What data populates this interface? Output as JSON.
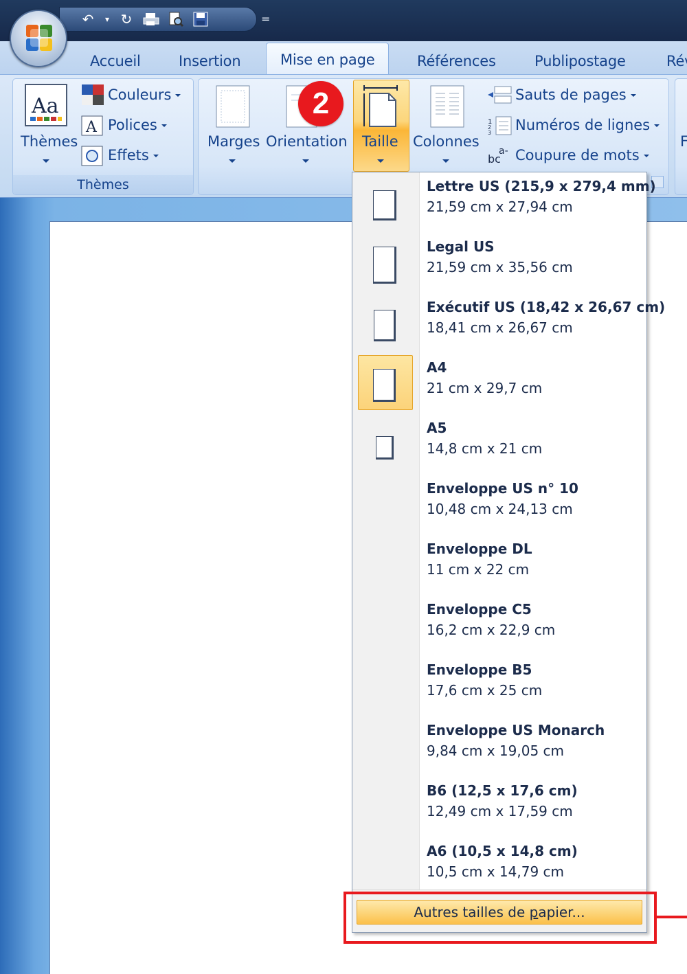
{
  "quick_access": {
    "icons": [
      "undo-icon",
      "undo-dropdown-icon",
      "redo-icon",
      "print-icon",
      "print-preview-icon",
      "save-icon"
    ],
    "more": "="
  },
  "tabs": [
    {
      "label": "Accueil",
      "active": false
    },
    {
      "label": "Insertion",
      "active": false
    },
    {
      "label": "Mise en page",
      "active": true
    },
    {
      "label": "Références",
      "active": false
    },
    {
      "label": "Publipostage",
      "active": false
    },
    {
      "label": "Rév",
      "active": false
    }
  ],
  "ribbon": {
    "themes_group": {
      "themes_label": "Thèmes",
      "couleurs": "Couleurs",
      "polices": "Polices",
      "effets": "Effets",
      "group_label": "Thèmes"
    },
    "page_setup": {
      "marges": "Marges",
      "orientation": "Orientation",
      "taille": "Taille",
      "colonnes": "Colonnes",
      "sauts": "Sauts de pages",
      "numeros": "Numéros de lignes",
      "coupure": "Coupure de mots",
      "coupure_icon_text": "bc",
      "coupure_icon_sup": "a-"
    },
    "cut_off_label": "F"
  },
  "callout": {
    "number": "2"
  },
  "size_menu": {
    "items": [
      {
        "name": "Lettre US (215,9 x 279,4 mm)",
        "dims": "21,59 cm x 27,94 cm"
      },
      {
        "name": "Legal US",
        "dims": "21,59 cm x 35,56 cm"
      },
      {
        "name": "Exécutif US (18,42 x 26,67 cm)",
        "dims": "18,41 cm x 26,67 cm"
      },
      {
        "name": "A4",
        "dims": "21 cm x 29,7 cm"
      },
      {
        "name": "A5",
        "dims": "14,8 cm x 21 cm"
      },
      {
        "name": "Enveloppe US n° 10",
        "dims": "10,48 cm x 24,13 cm"
      },
      {
        "name": "Enveloppe DL",
        "dims": "11 cm x 22 cm"
      },
      {
        "name": "Enveloppe C5",
        "dims": "16,2 cm x 22,9 cm"
      },
      {
        "name": "Enveloppe B5",
        "dims": "17,6 cm x 25 cm"
      },
      {
        "name": "Enveloppe US Monarch",
        "dims": "9,84 cm x 19,05 cm"
      },
      {
        "name": "B6 (12,5 x 17,6 cm)",
        "dims": "12,49 cm x 17,59 cm"
      },
      {
        "name": "A6 (10,5 x 14,8 cm)",
        "dims": "10,5 cm x 14,79 cm"
      }
    ],
    "selected": "A4",
    "more_sizes_pre": "Autres tailles de ",
    "more_sizes_ul": "p",
    "more_sizes_post": "apier..."
  },
  "colors": {
    "accent_red": "#e8191e",
    "ribbon_text": "#15428b",
    "highlight": "#fcd67c"
  }
}
